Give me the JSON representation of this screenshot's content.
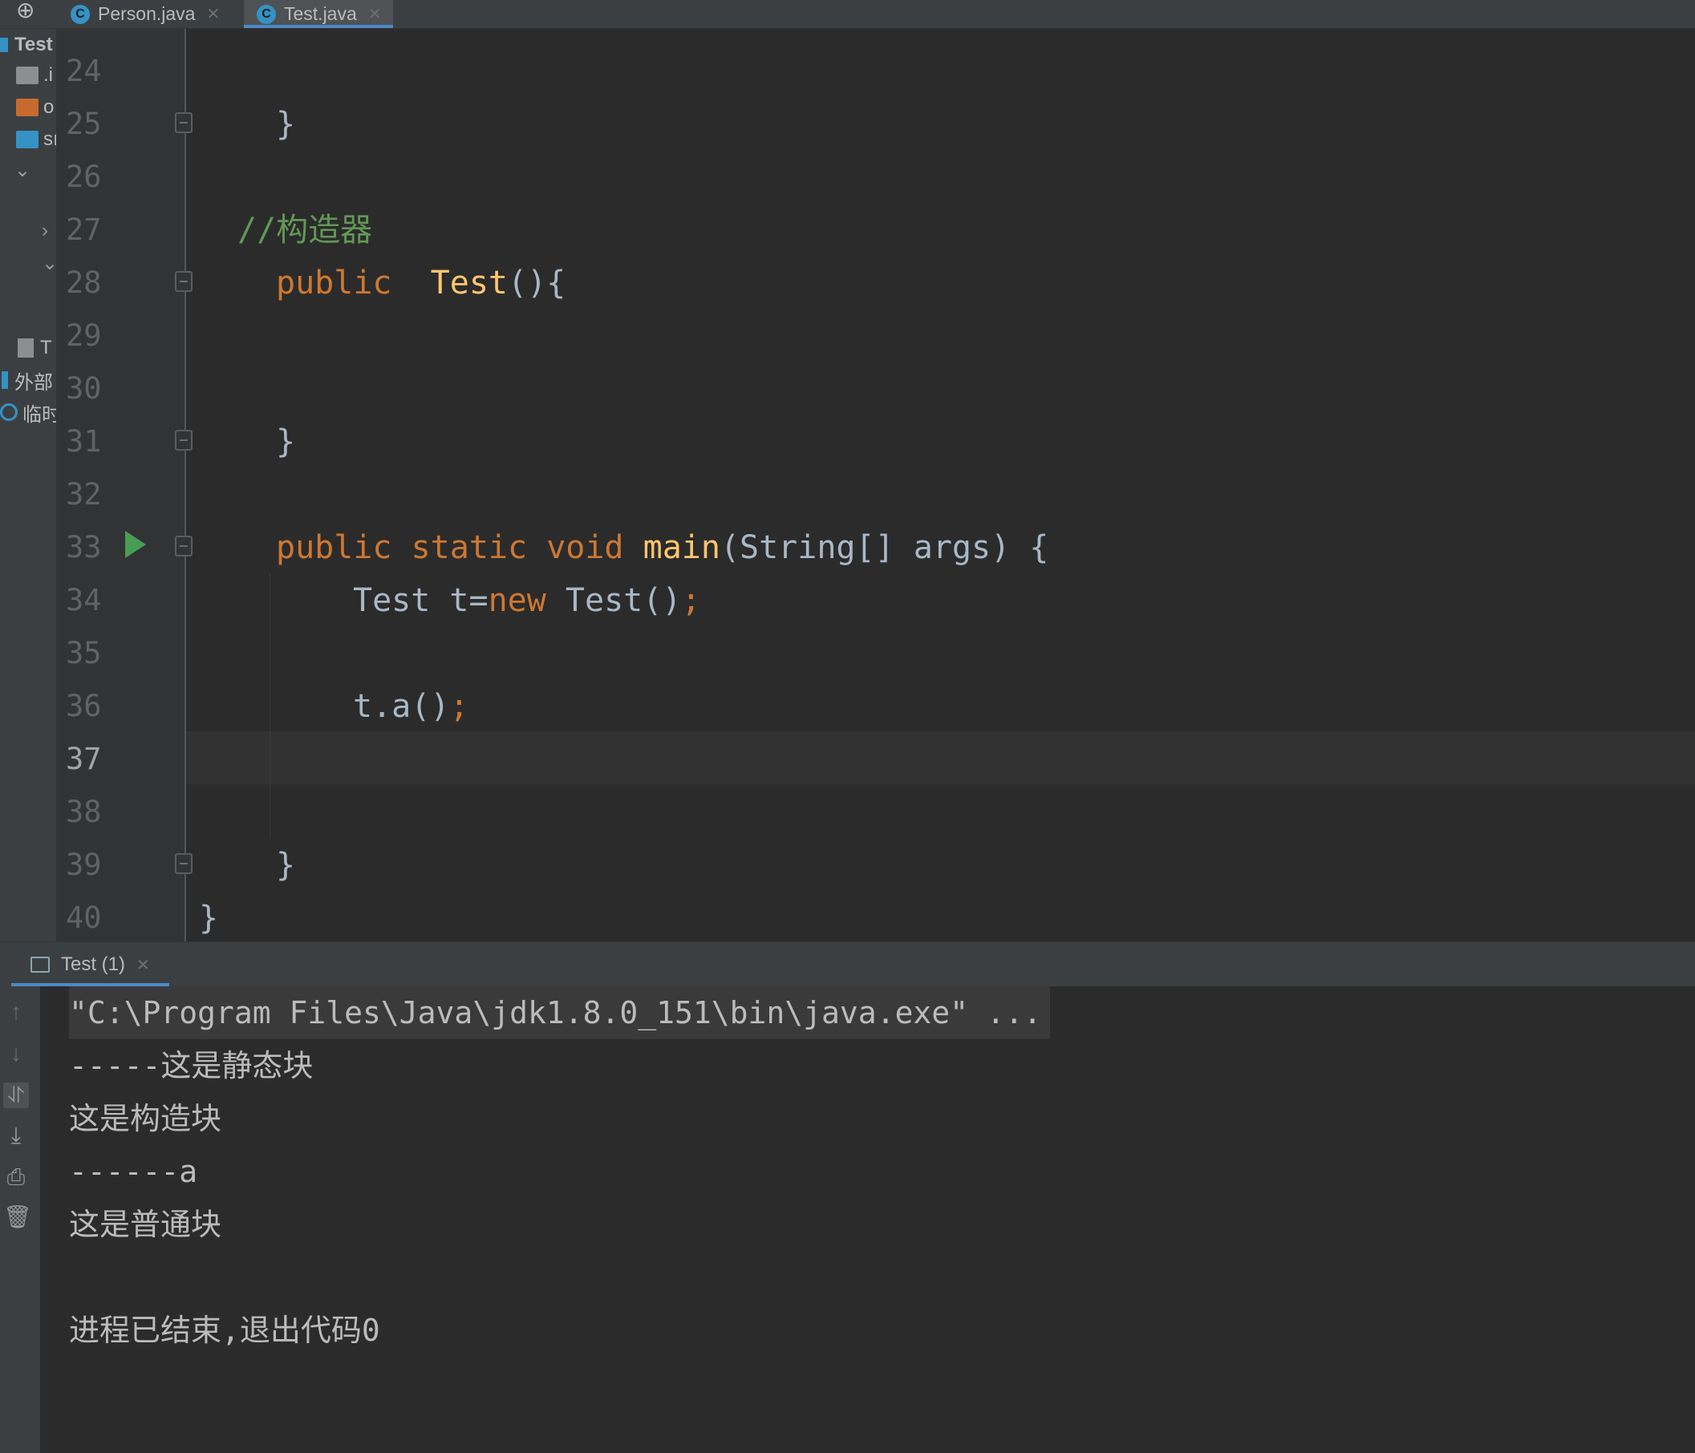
{
  "tabs": [
    {
      "label": "Person.java",
      "icon": "class-icon",
      "icon_letter": "C",
      "active": false
    },
    {
      "label": "Test.java",
      "icon": "class-icon",
      "icon_letter": "C",
      "active": true
    }
  ],
  "project_panel": {
    "root": "Test",
    "rows": [
      ".i",
      "o",
      "sı",
      "T",
      "外部",
      "临时"
    ]
  },
  "editor": {
    "line_numbers": [
      "24",
      "25",
      "26",
      "27",
      "28",
      "29",
      "30",
      "31",
      "32",
      "33",
      "34",
      "35",
      "36",
      "37",
      "38",
      "39",
      "40"
    ],
    "current_line": "37",
    "code": {
      "l25": "}",
      "l27_comment": "//构造器",
      "l28_kw": "public",
      "l28_fn": "Test",
      "l28_rest": "(){",
      "l31": "}",
      "l33_kw1": "public",
      "l33_kw2": "static",
      "l33_kw3": "void",
      "l33_fn": "main",
      "l33_rest": "(String[] args) {",
      "l34_a": "Test t=",
      "l34_kw": "new",
      "l34_b": " Test()",
      "l34_semi": ";",
      "l36_a": "t.a()",
      "l36_semi": ";",
      "l39": "}",
      "l40": "}"
    }
  },
  "run_panel": {
    "tab_label": "Test (1)",
    "output": [
      "\"C:\\Program Files\\Java\\jdk1.8.0_151\\bin\\java.exe\" ...",
      "-----这是静态块",
      "这是构造块",
      "------a",
      "这是普通块",
      "",
      "进程已结束,退出代码0"
    ]
  },
  "colors": {
    "keyword": "#cc7832",
    "function": "#ffc66d",
    "comment": "#629755",
    "text": "#a9b7c6",
    "run_icon": "#499c54",
    "accent": "#4a88c7"
  }
}
